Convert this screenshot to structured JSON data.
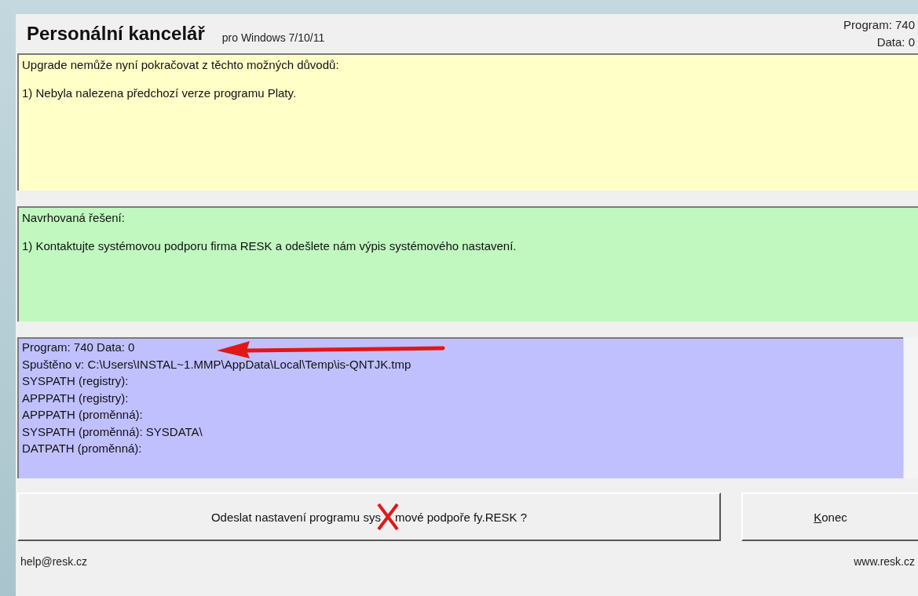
{
  "header": {
    "title": "Personální kancelář",
    "subtitle": "pro Windows 7/10/11",
    "version_lines": [
      "Program: 740",
      "Data: 0"
    ]
  },
  "panels": [
    {
      "kind": "problem",
      "paragraphs": [
        "Upgrade nemůže nyní pokračovat z těchto možných důvodů:",
        "1) Nebyla nalezena předchozí verze programu Platy."
      ]
    },
    {
      "kind": "solution",
      "paragraphs": [
        "Navrhovaná řešení:",
        "1) Kontaktujte systémovou podporu firma RESK a odešlete nám výpis systémového nastavení."
      ]
    },
    {
      "kind": "info",
      "lines": [
        "Program: 740 Data: 0",
        "Spuštěno v: C:\\Users\\INSTAL~1.MMP\\AppData\\Local\\Temp\\is-QNTJK.tmp",
        "SYSPATH (registry):",
        "APPPATH (registry):",
        "APPPATH (proměnná):",
        "SYSPATH (proměnná): SYSDATA\\",
        "DATPATH (proměnná):"
      ]
    }
  ],
  "buttons": [
    {
      "kind": "send",
      "label_parts": [
        "Odeslat nastavení programu sys",
        "mové podpoře fy.RESK ?"
      ]
    },
    {
      "kind": "close",
      "label_parts": [
        "Konec"
      ]
    }
  ],
  "footer": {
    "email": "help@resk.cz",
    "website": "www.resk.cz"
  }
}
